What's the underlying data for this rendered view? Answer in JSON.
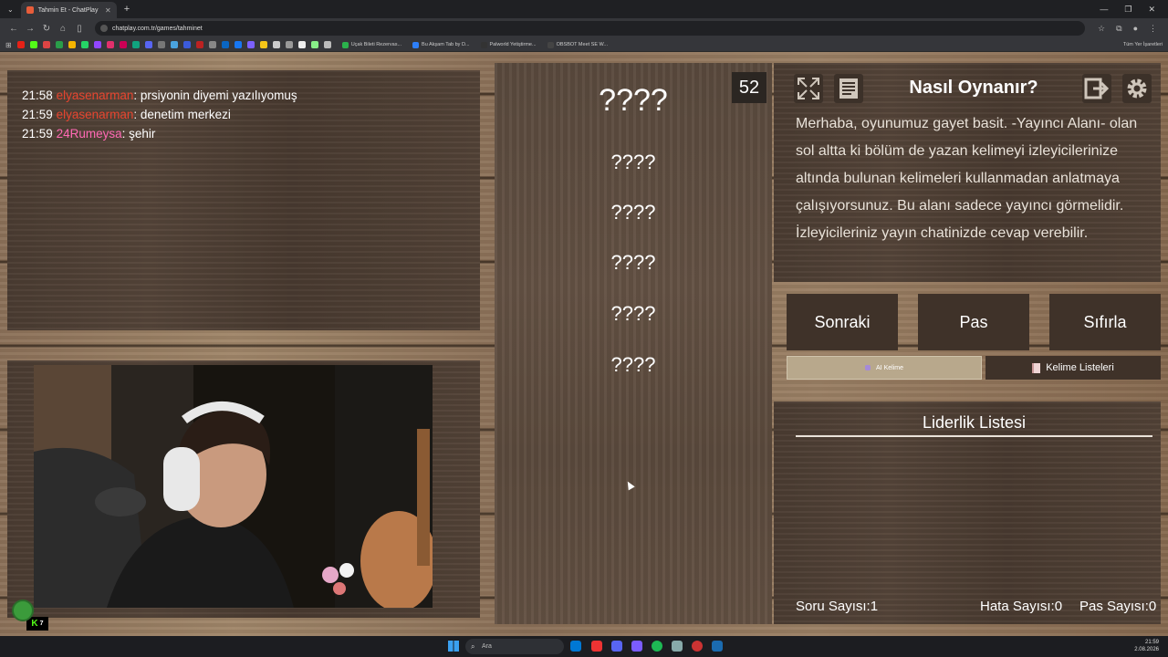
{
  "browser": {
    "tab_title": "Tahmin Et - ChatPlay",
    "url": "chatplay.com.tr/games/tahminet",
    "bookmarks": [
      "Uçak Bileti Rezervas...",
      "Bu Akşam Tab by D...",
      "Palworld Yetiştirme...",
      "OBSBOT Meet SE W..."
    ],
    "all_bookmarks": "Tüm Yer İşaretleri"
  },
  "chat": {
    "messages": [
      {
        "time": "21:58",
        "user": "elyasenarman",
        "text": ": prsiyonin diyemi yazılıyomuş"
      },
      {
        "time": "21:59",
        "user": "elyasenarman",
        "text": ": denetim merkezi"
      },
      {
        "time": "21:59",
        "user": "24Rumeysa",
        "text": ": şehir"
      }
    ]
  },
  "game": {
    "timer": "52",
    "main_word": "????",
    "forbidden_words": [
      "????",
      "????",
      "????",
      "????",
      "????"
    ]
  },
  "howto": {
    "title": "Nasıl Oynanır?",
    "text": "Merhaba, oyunumuz gayet basit. -Yayıncı Alanı- olan sol altta ki bölüm de yazan kelimeyi izleyicilerinize altında bulunan kelimeleri kullanmadan anlatmaya çalışıyorsunuz. Bu alanı sadece yayıncı görmelidir. İzleyicileriniz yayın chatinizde cevap verebilir."
  },
  "actions": {
    "next": "Sonraki",
    "pass": "Pas",
    "reset": "Sıfırla",
    "ai_word": "AI Kelime",
    "word_lists": "Kelime Listeleri"
  },
  "leaderboard": {
    "title": "Liderlik Listesi",
    "question_count": "Soru Sayısı:1",
    "error_count": "Hata Sayısı:0",
    "pass_count": "Pas Sayısı:0"
  },
  "taskbar": {
    "search": "Ara",
    "time": "21:59",
    "date": "2.08.2026"
  },
  "colors": {
    "chat_user_red": "#e8452f",
    "chat_user_pink": "#ff69b4",
    "ai_button_bg": "#b8a88c"
  }
}
